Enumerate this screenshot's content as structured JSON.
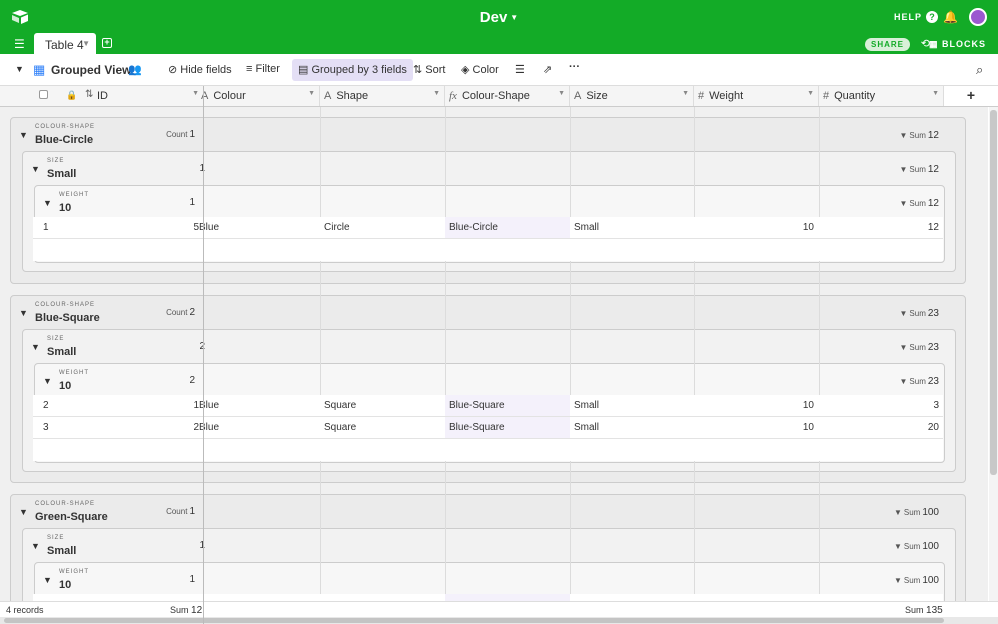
{
  "app": {
    "base_title": "Dev",
    "help_label": "HELP",
    "share_label": "SHARE",
    "blocks_label": "BLOCKS"
  },
  "table_tab": {
    "label": "Table 4"
  },
  "view": {
    "name": "Grouped View",
    "hide_fields": "Hide fields",
    "filter": "Filter",
    "grouped": "Grouped by 3 fields",
    "sort": "Sort",
    "color": "Color"
  },
  "columns": [
    {
      "label": "ID",
      "icon": "sort-icon"
    },
    {
      "label": "Colour",
      "icon": "text-icon"
    },
    {
      "label": "Shape",
      "icon": "text-icon"
    },
    {
      "label": "Colour-Shape",
      "icon": "formula-icon"
    },
    {
      "label": "Size",
      "icon": "text-icon"
    },
    {
      "label": "Weight",
      "icon": "number-icon"
    },
    {
      "label": "Quantity",
      "icon": "number-icon"
    }
  ],
  "group_field_labels": {
    "level1": "COLOUR-SHAPE",
    "level2": "SIZE",
    "level3": "WEIGHT",
    "count_label": "Count",
    "sum_label": "Sum"
  },
  "groups": [
    {
      "name": "Blue-Circle",
      "count": "1",
      "sum": "12",
      "size": {
        "name": "Small",
        "count": "1",
        "sum": "12"
      },
      "weight": {
        "name": "10",
        "count": "1",
        "sum": "12"
      },
      "rows": [
        {
          "num": "1",
          "id": "5",
          "colour": "Blue",
          "shape": "Circle",
          "colour_shape": "Blue-Circle",
          "size": "Small",
          "weight": "10",
          "quantity": "12"
        }
      ]
    },
    {
      "name": "Blue-Square",
      "count": "2",
      "sum": "23",
      "size": {
        "name": "Small",
        "count": "2",
        "sum": "23"
      },
      "weight": {
        "name": "10",
        "count": "2",
        "sum": "23"
      },
      "rows": [
        {
          "num": "2",
          "id": "1",
          "colour": "Blue",
          "shape": "Square",
          "colour_shape": "Blue-Square",
          "size": "Small",
          "weight": "10",
          "quantity": "3"
        },
        {
          "num": "3",
          "id": "2",
          "colour": "Blue",
          "shape": "Square",
          "colour_shape": "Blue-Square",
          "size": "Small",
          "weight": "10",
          "quantity": "20"
        }
      ]
    },
    {
      "name": "Green-Square",
      "count": "1",
      "sum": "100",
      "size": {
        "name": "Small",
        "count": "1",
        "sum": "100"
      },
      "weight": {
        "name": "10",
        "count": "1",
        "sum": "100"
      },
      "rows": []
    }
  ],
  "footer": {
    "records": "4 records",
    "left_sum_label": "Sum",
    "left_sum": "12",
    "right_sum_label": "Sum",
    "right_sum": "135"
  },
  "colors": {
    "topbar": "#13ab27",
    "formula_column": "#f4f1fb",
    "grouped_button": "#e4dff5",
    "avatar": "#9b59d0"
  }
}
